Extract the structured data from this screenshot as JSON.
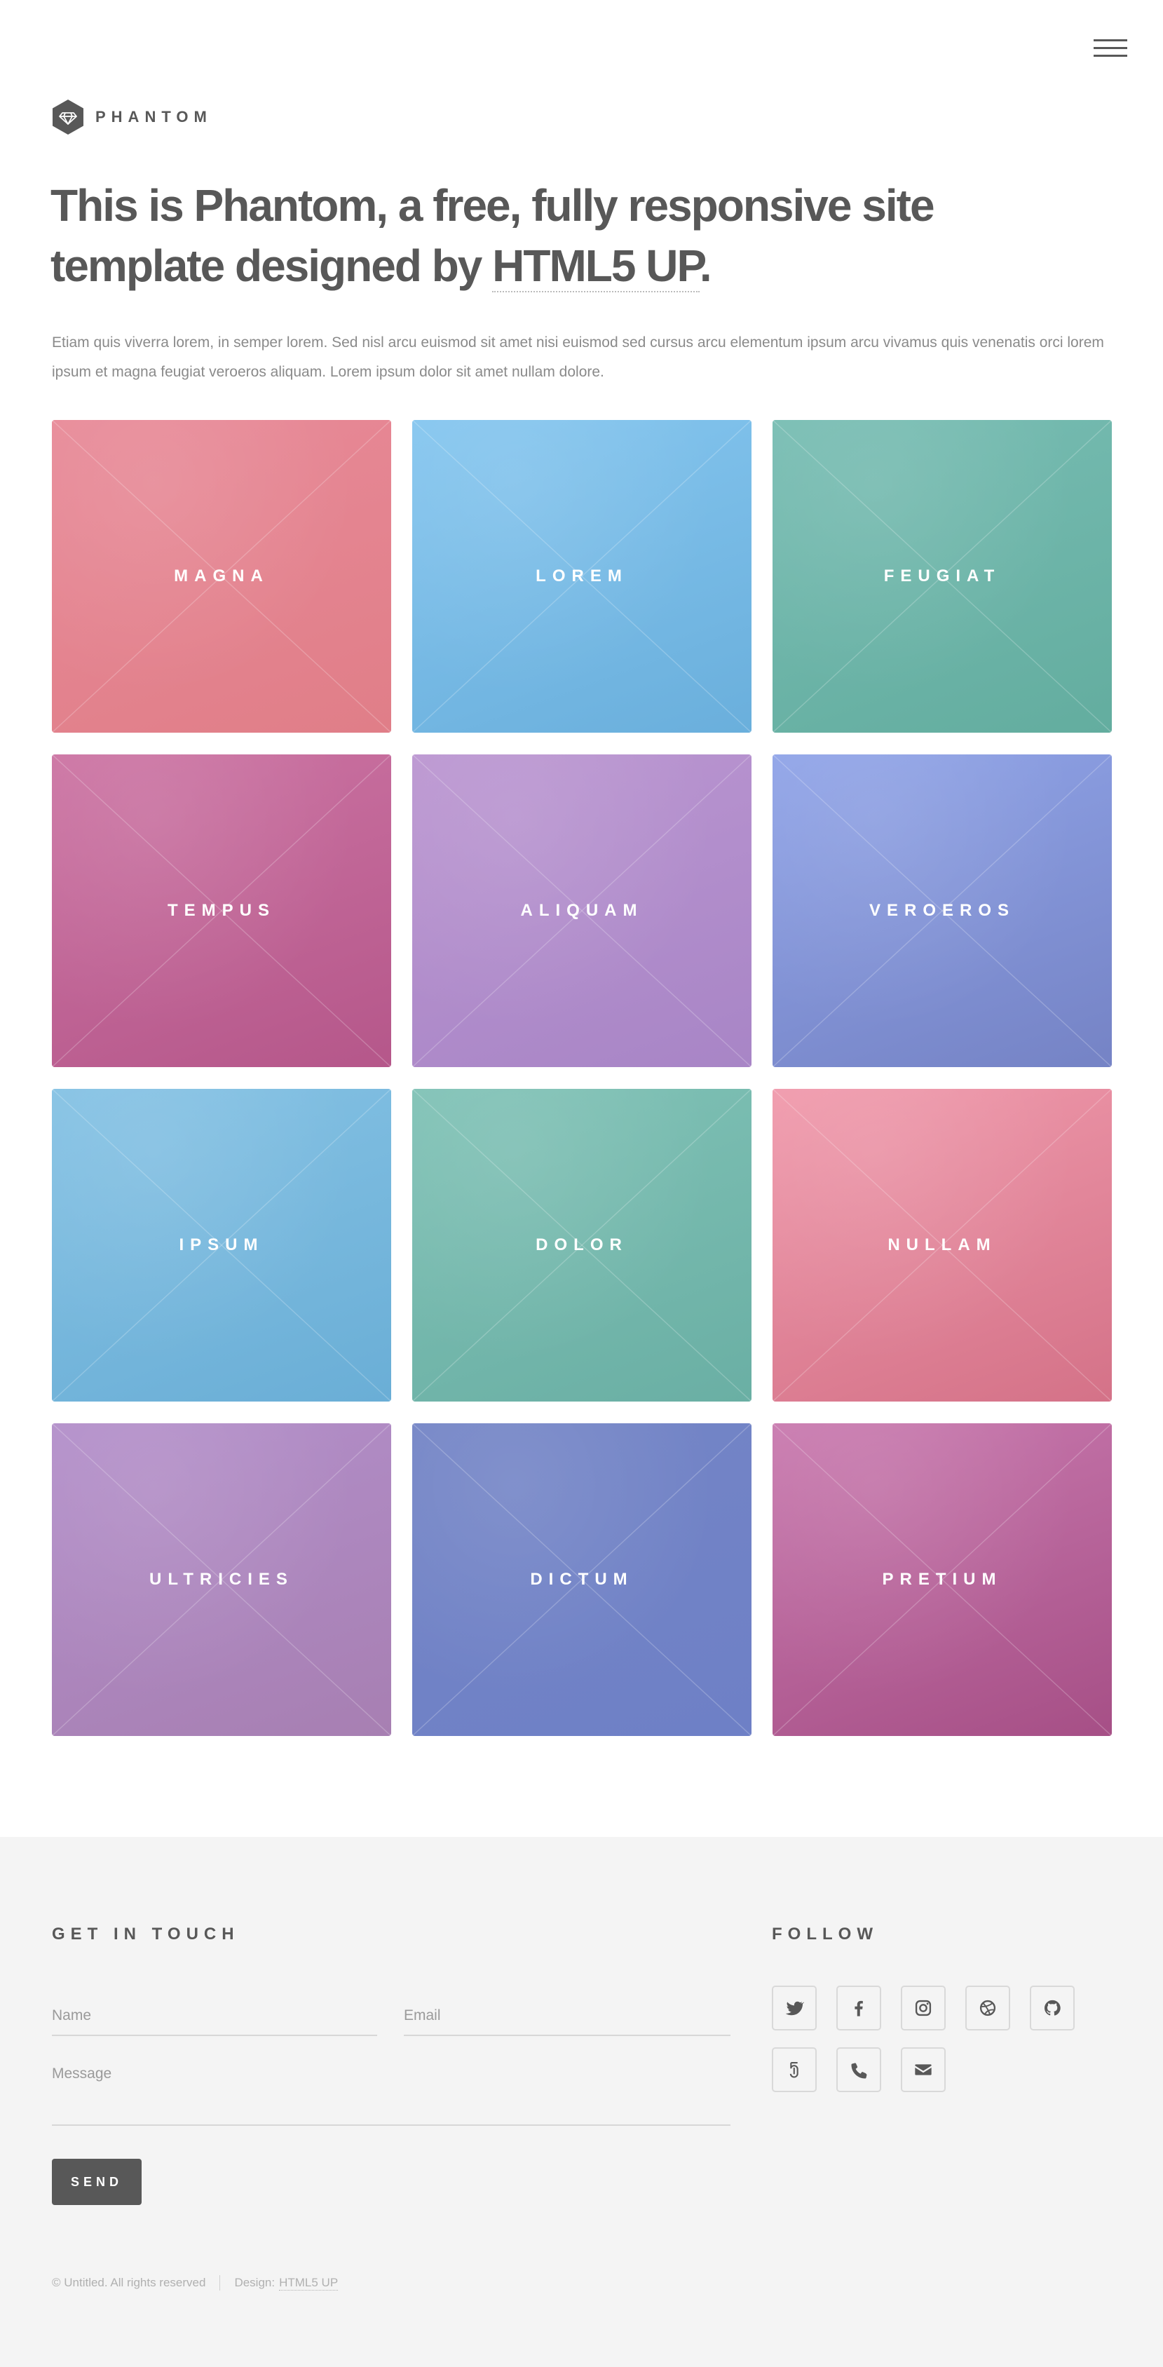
{
  "header": {
    "logo_text": "PHANTOM",
    "headline_prefix": "This is Phantom, a free, fully responsive site template designed by ",
    "headline_link": "HTML5 UP",
    "headline_suffix": ".",
    "intro": "Etiam quis viverra lorem, in semper lorem. Sed nisl arcu euismod sit amet nisi euismod sed cursus arcu elementum ipsum arcu vivamus quis venenatis orci lorem ipsum et magna feugiat veroeros aliquam. Lorem ipsum dolor sit amet nullam dolore."
  },
  "tiles": [
    {
      "label": "MAGNA",
      "color_a": "#e88a98",
      "color_b": "#e07e88"
    },
    {
      "label": "LOREM",
      "color_a": "#85c6ef",
      "color_b": "#6aafdc"
    },
    {
      "label": "FEUGIAT",
      "color_a": "#78bdb3",
      "color_b": "#63ad9f"
    },
    {
      "label": "TEMPUS",
      "color_a": "#cc74a3",
      "color_b": "#b5578a"
    },
    {
      "label": "ALIQUAM",
      "color_a": "#bb96d1",
      "color_b": "#a885c6"
    },
    {
      "label": "VEROEROS",
      "color_a": "#90a4e8",
      "color_b": "#7583c5"
    },
    {
      "label": "IPSUM",
      "color_a": "#85c2e4",
      "color_b": "#6aaed6"
    },
    {
      "label": "DOLOR",
      "color_a": "#80c2b6",
      "color_b": "#6aafa4"
    },
    {
      "label": "NULLAM",
      "color_a": "#f09aac",
      "color_b": "#d47288"
    },
    {
      "label": "ULTRICIES",
      "color_a": "#b38fca",
      "color_b": "#a77fb2"
    },
    {
      "label": "DICTUM",
      "color_a": "#7485c6",
      "color_b": "#6e80c6"
    },
    {
      "label": "PRETIUM",
      "color_a": "#c97aaf",
      "color_b": "#a64f86"
    }
  ],
  "contact": {
    "title": "GET IN TOUCH",
    "name_placeholder": "Name",
    "email_placeholder": "Email",
    "message_placeholder": "Message",
    "send_label": "SEND"
  },
  "follow": {
    "title": "FOLLOW",
    "icons": [
      "twitter-icon",
      "facebook-icon",
      "instagram-icon",
      "dribbble-icon",
      "github-icon",
      "500px-icon",
      "phone-icon",
      "envelope-icon"
    ]
  },
  "footer": {
    "copyright": "© Untitled. All rights reserved",
    "design_label": "Design:",
    "design_link": "HTML5 UP"
  },
  "colors": {
    "text": "#585858",
    "footer_bg": "#f4f4f4",
    "button_bg": "#585858"
  }
}
